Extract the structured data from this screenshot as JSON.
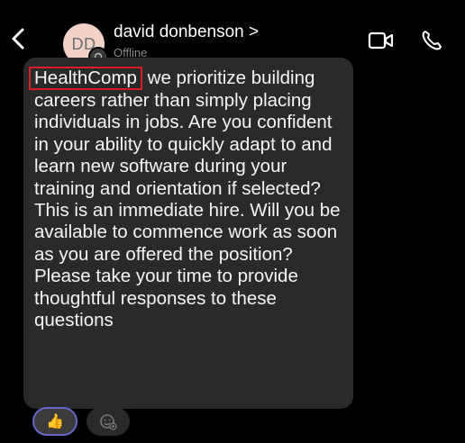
{
  "header": {
    "avatar_initials": "DD",
    "contact_name": "david donbenson >",
    "status": "Offline"
  },
  "message": {
    "highlighted_word": "HealthComp",
    "text": [
      " we prioritize building careers rather than simply placing individuals in jobs. Are you confident in your ability to quickly adapt to and learn new software during your training and orientation if selected?",
      "This is an immediate hire. Will you be available to commence work as soon as you are offered the position?",
      "Please take your time to provide thoughtful responses to these questions"
    ]
  },
  "reactions": {
    "like_emoji": "👍",
    "add_reaction_icon": "emoji-add-icon"
  },
  "icons": {
    "back": "chevron-left-icon",
    "video": "video-camera-icon",
    "call": "phone-icon"
  },
  "colors": {
    "background": "#000000",
    "bubble": "#2a2a2a",
    "highlight_box": "#d81f26",
    "reaction_border": "#6767c8",
    "avatar_bg": "#f3d2c6"
  }
}
